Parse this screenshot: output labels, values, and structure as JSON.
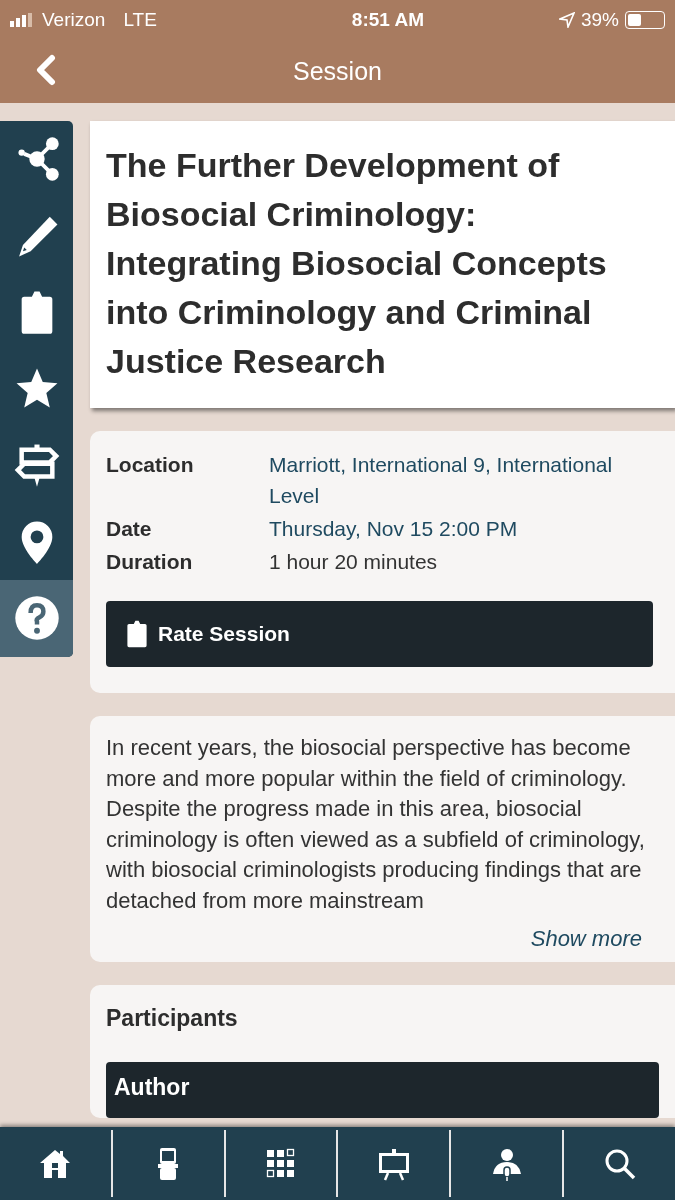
{
  "status_bar": {
    "carrier": "Verizon",
    "network": "LTE",
    "time": "8:51 AM",
    "battery_text": "39%"
  },
  "nav": {
    "title": "Session"
  },
  "sidebar": {
    "items": [
      {
        "selected": false
      },
      {
        "selected": false
      },
      {
        "selected": false
      },
      {
        "selected": false
      },
      {
        "selected": false
      },
      {
        "selected": false
      },
      {
        "selected": true
      }
    ]
  },
  "session": {
    "title": "The Further Development of Biosocial Criminology: Integrating Biosocial Concepts into Criminology and Criminal Justice Research",
    "details": [
      {
        "label": "Location",
        "value": "Marriott, International 9, International Level",
        "kind": "link"
      },
      {
        "label": "Date",
        "value": "Thursday, Nov 15 2:00 PM",
        "kind": "link"
      },
      {
        "label": "Duration",
        "value": "1 hour 20 minutes",
        "kind": "plain"
      }
    ],
    "rate_button": "Rate Session"
  },
  "description": {
    "text": "In recent years, the biosocial perspective has become more and more popular within the field of criminology. Despite the progress made in this area, biosocial criminology is often viewed as a subfield of criminology, with biosocial criminologists producing findings that are detached from more mainstream",
    "show_more": "Show more"
  },
  "participants": {
    "heading": "Participants",
    "groups": [
      {
        "role": "Author"
      }
    ]
  },
  "tab_bar": {
    "items": [
      {
        "selected": false
      },
      {
        "selected": false
      },
      {
        "selected": false
      },
      {
        "selected": false
      },
      {
        "selected": false
      },
      {
        "selected": false
      }
    ]
  }
}
